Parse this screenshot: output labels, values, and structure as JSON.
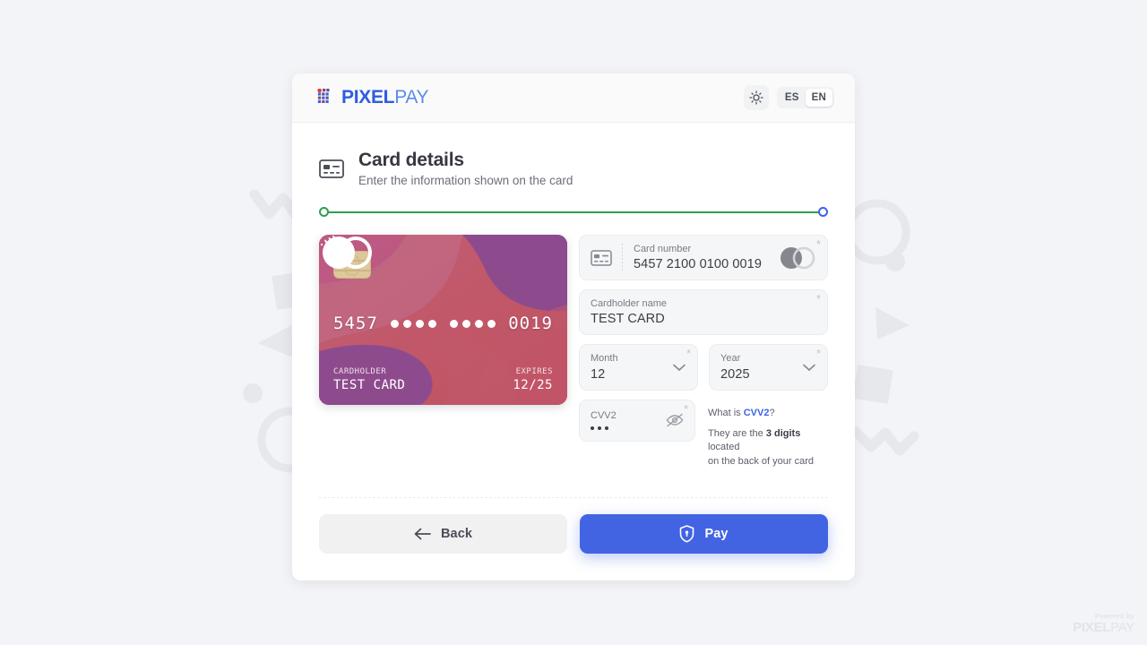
{
  "brand": {
    "name_bold": "PIXEL",
    "name_light": "PAY",
    "accent": "#2f5ce0"
  },
  "header": {
    "theme_toggle_icon": "sun-icon",
    "languages": [
      {
        "code": "ES",
        "selected": false
      },
      {
        "code": "EN",
        "selected": true
      }
    ]
  },
  "page": {
    "title": "Card details",
    "subtitle": "Enter the information shown on the card",
    "title_icon": "card-details-icon"
  },
  "progress": {
    "start_color": "#2f9e4f",
    "end_color": "#3b63e8",
    "line_color": "#2f9e4f"
  },
  "card_preview": {
    "number_first": "5457",
    "number_masked_group_1": "••••",
    "number_masked_group_2": "••••",
    "number_last": "0019",
    "cardholder_label": "CARDHOLDER",
    "cardholder_value": "TEST CARD",
    "expires_label": "EXPIRES",
    "expires_value": "12/25",
    "brand_mark": "mastercard-logo",
    "chip_icon": "emv-chip-icon",
    "contactless_icon": "contactless-icon"
  },
  "form": {
    "card_number": {
      "label": "Card number",
      "value": "5457 2100 0100 0019",
      "required_mark": "*",
      "icon": "credit-card-icon",
      "brand_icon": "mastercard-gray-icon"
    },
    "cardholder_name": {
      "label": "Cardholder name",
      "value": "TEST CARD",
      "required_mark": "*"
    },
    "month": {
      "label": "Month",
      "value": "12",
      "required_mark": "*",
      "icon": "chevron-down-icon"
    },
    "year": {
      "label": "Year",
      "value": "2025",
      "required_mark": "*",
      "icon": "chevron-down-icon"
    },
    "cvv2": {
      "label": "CVV2",
      "value": "•••",
      "required_mark": "*",
      "icon": "eye-off-icon"
    },
    "cvv_help": {
      "line1_prefix": "What is ",
      "line1_term": "CVV2",
      "line1_suffix": "?",
      "line2_prefix": "They are the ",
      "line2_strong": "3 digits",
      "line2_mid": " located",
      "line3": "on the back of your card"
    }
  },
  "footer": {
    "back_label": "Back",
    "back_icon": "arrow-left-icon",
    "pay_label": "Pay",
    "pay_icon": "shield-lock-icon",
    "pay_color": "#4264e3"
  },
  "watermark": {
    "top": "Powered by",
    "bold": "PIXEL",
    "light": "PAY"
  }
}
